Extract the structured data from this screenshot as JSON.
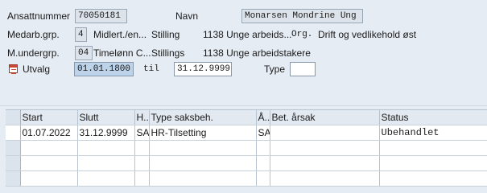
{
  "header": {
    "ansattnummer": {
      "label": "Ansattnummer",
      "value": "70050181"
    },
    "navn": {
      "label": "Navn",
      "value": "Monarsen Mondrine Ung"
    },
    "medarb_grp": {
      "label": "Medarb.grp.",
      "code": "4",
      "text": "Midlert./en..."
    },
    "stilling": {
      "label": "Stilling",
      "value": "1138 Unge arbeids..."
    },
    "org": {
      "label": "Org.",
      "value": "Drift og vedlikehold øst"
    },
    "m_undergrp": {
      "label": "M.undergrp.",
      "code": "04",
      "text": "Timelønn C..."
    },
    "stillings": {
      "label": "Stillings",
      "value": "1138 Unge arbeidstakere"
    },
    "utvalg": {
      "label": "Utvalg",
      "from": "01.01.1800",
      "til_label": "til",
      "to": "31.12.9999",
      "type_label": "Type",
      "type_value": ""
    }
  },
  "table": {
    "columns": [
      "Start",
      "Slutt",
      "H..",
      "Type saksbeh.",
      "Å..",
      "Bet. årsak",
      "Status"
    ],
    "rows": [
      [
        "01.07.2022",
        "31.12.9999",
        "SA",
        "HR-Tilsetting",
        "SA",
        "",
        "Ubehandlet"
      ],
      [
        "",
        "",
        "",
        "",
        "",
        "",
        ""
      ],
      [
        "",
        "",
        "",
        "",
        "",
        "",
        ""
      ],
      [
        "",
        "",
        "",
        "",
        "",
        "",
        ""
      ]
    ]
  }
}
